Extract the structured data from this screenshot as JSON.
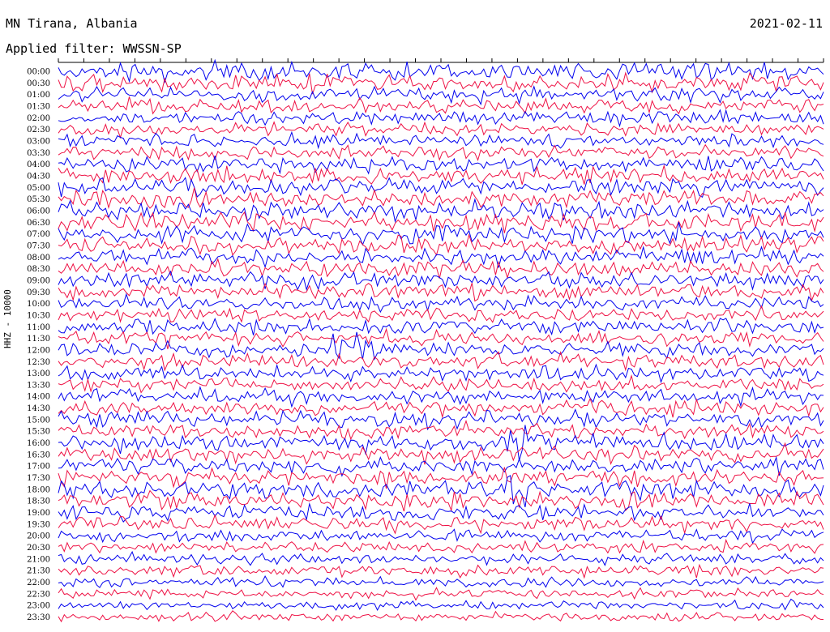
{
  "header": {
    "station": "MN Tirana, Albania",
    "date": "2021-02-11",
    "filter": "Applied filter: WWSSN-SP"
  },
  "channel_label": "HHZ - 10000",
  "chart_data": {
    "type": "line",
    "title": "MN Tirana, Albania",
    "ylabel": "HHZ - 10000",
    "row_labels": [
      "00:00",
      "00:30",
      "01:00",
      "01:30",
      "02:00",
      "02:30",
      "03:00",
      "03:30",
      "04:00",
      "04:30",
      "05:00",
      "05:30",
      "06:00",
      "06:30",
      "07:00",
      "07:30",
      "08:00",
      "08:30",
      "09:00",
      "09:30",
      "10:00",
      "10:30",
      "11:00",
      "11:30",
      "12:00",
      "12:30",
      "13:00",
      "13:30",
      "14:00",
      "14:30",
      "15:00",
      "15:30",
      "16:00",
      "16:30",
      "17:00",
      "17:30",
      "18:00",
      "18:30",
      "19:00",
      "19:30",
      "20:00",
      "20:30",
      "21:00",
      "21:30",
      "22:00",
      "22:30",
      "23:00",
      "23:30"
    ],
    "trace_colors": [
      "#0000ee",
      "#ee1144"
    ],
    "relative_amplitude": [
      1.3,
      1.4,
      1.2,
      1.2,
      1.1,
      1.1,
      1.1,
      1.1,
      1.3,
      1.3,
      1.4,
      1.5,
      1.5,
      1.5,
      1.4,
      1.4,
      1.4,
      1.3,
      1.3,
      1.2,
      1.2,
      1.2,
      1.2,
      1.2,
      1.2,
      1.2,
      1.2,
      1.1,
      1.2,
      1.2,
      1.2,
      1.2,
      1.4,
      1.4,
      1.3,
      1.3,
      1.5,
      1.4,
      1.4,
      1.2,
      1.0,
      0.9,
      0.9,
      0.9,
      0.8,
      0.8,
      0.7,
      0.7
    ],
    "events": [
      {
        "row": "12:00",
        "amplitude": 3.5
      },
      {
        "row": "16:00",
        "amplitude": 2.2
      },
      {
        "row": "18:00",
        "amplitude": 2.0
      }
    ]
  }
}
